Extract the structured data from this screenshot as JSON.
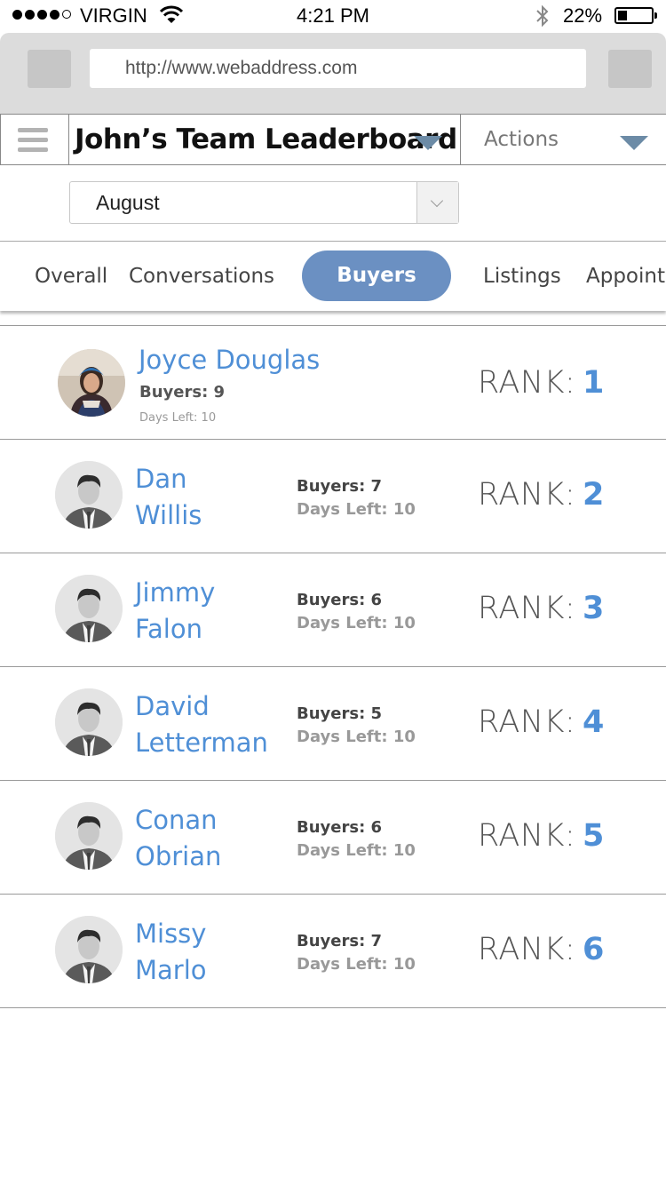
{
  "status_bar": {
    "carrier": "VIRGIN",
    "time": "4:21 PM",
    "battery": "22%",
    "battery_level": 0.22
  },
  "browser": {
    "url": "http://www.webaddress.com"
  },
  "header": {
    "title": "John’s Team Leaderboard",
    "actions_label": "Actions"
  },
  "filter": {
    "month": "August"
  },
  "tabs": [
    {
      "label": "Overall",
      "active": false
    },
    {
      "label": "Conversations",
      "active": false
    },
    {
      "label": "Buyers",
      "active": true
    },
    {
      "label": "Listings",
      "active": false
    },
    {
      "label": "Appoint",
      "active": false
    }
  ],
  "rank_label": "RANK:",
  "leaders": [
    {
      "name": "Joyce Douglas",
      "buyers": "Buyers: 9",
      "days_left": "Days Left: 10",
      "rank": "1"
    },
    {
      "name_first": "Dan",
      "name_last": "Willis",
      "buyers": "Buyers: 7",
      "days_left": "Days Left: 10",
      "rank": "2"
    },
    {
      "name_first": "Jimmy",
      "name_last": "Falon",
      "buyers": "Buyers: 6",
      "days_left": "Days Left: 10",
      "rank": "3"
    },
    {
      "name_first": "David",
      "name_last": "Letterman",
      "buyers": "Buyers: 5",
      "days_left": "Days Left: 10",
      "rank": "4"
    },
    {
      "name_first": "Conan",
      "name_last": "Obrian",
      "buyers": "Buyers: 6",
      "days_left": "Days Left: 10",
      "rank": "5"
    },
    {
      "name_first": "Missy",
      "name_last": "Marlo",
      "buyers": "Buyers: 7",
      "days_left": "Days Left: 10",
      "rank": "6"
    }
  ],
  "colors": {
    "accent": "#4f8fd6",
    "tab_active": "#6b90c2",
    "dropdown_arrow": "#6c8ba6"
  }
}
